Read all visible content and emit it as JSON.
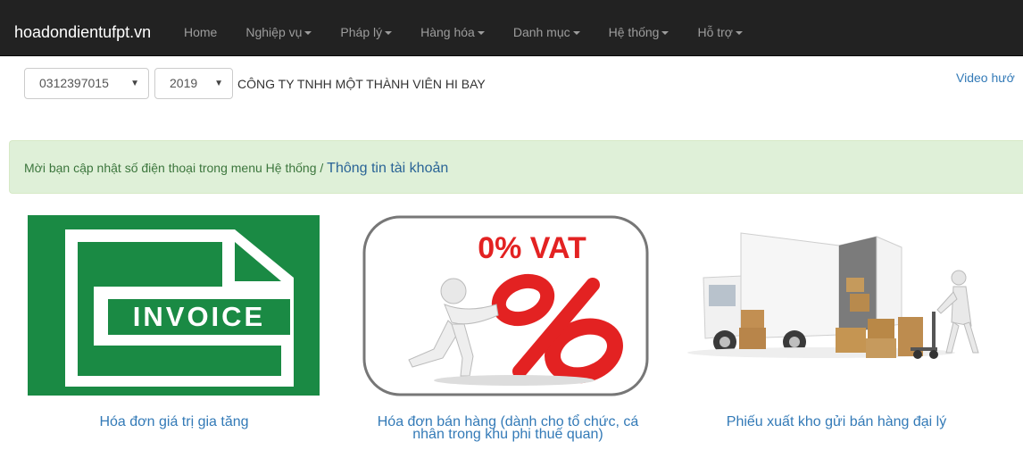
{
  "navbar": {
    "brand": "hoadondientufpt.vn",
    "items": [
      {
        "label": "Home",
        "has_caret": false
      },
      {
        "label": "Nghiệp vụ",
        "has_caret": true
      },
      {
        "label": "Pháp lý",
        "has_caret": true
      },
      {
        "label": "Hàng hóa",
        "has_caret": true
      },
      {
        "label": "Danh mục",
        "has_caret": true
      },
      {
        "label": "Hệ thống",
        "has_caret": true
      },
      {
        "label": "Hỗ trợ",
        "has_caret": true
      }
    ]
  },
  "toolbar": {
    "tax_code": "0312397015",
    "year": "2019",
    "company_name": "CÔNG TY TNHH MỘT THÀNH VIÊN HI BAY",
    "video_link": "Video hướ"
  },
  "alert": {
    "text": "Mời bạn cập nhật số điện thoại trong menu Hệ thống / ",
    "link": "Thông tin tài khoản"
  },
  "cards": [
    {
      "image_text": "INVOICE",
      "label": "Hóa đơn giá trị gia tăng"
    },
    {
      "image_text": "0% VAT",
      "label_line1": "Hóa đơn bán hàng (dành cho tổ chức, cá",
      "label_line2": "nhân trong khu phi thuế quan)"
    },
    {
      "label": "Phiếu xuất kho gửi bán hàng đại lý"
    }
  ],
  "colors": {
    "navbar_bg": "#222222",
    "alert_bg": "#dff0d8",
    "link": "#337ab7",
    "invoice_green": "#1a8a44",
    "vat_red": "#e32222"
  }
}
